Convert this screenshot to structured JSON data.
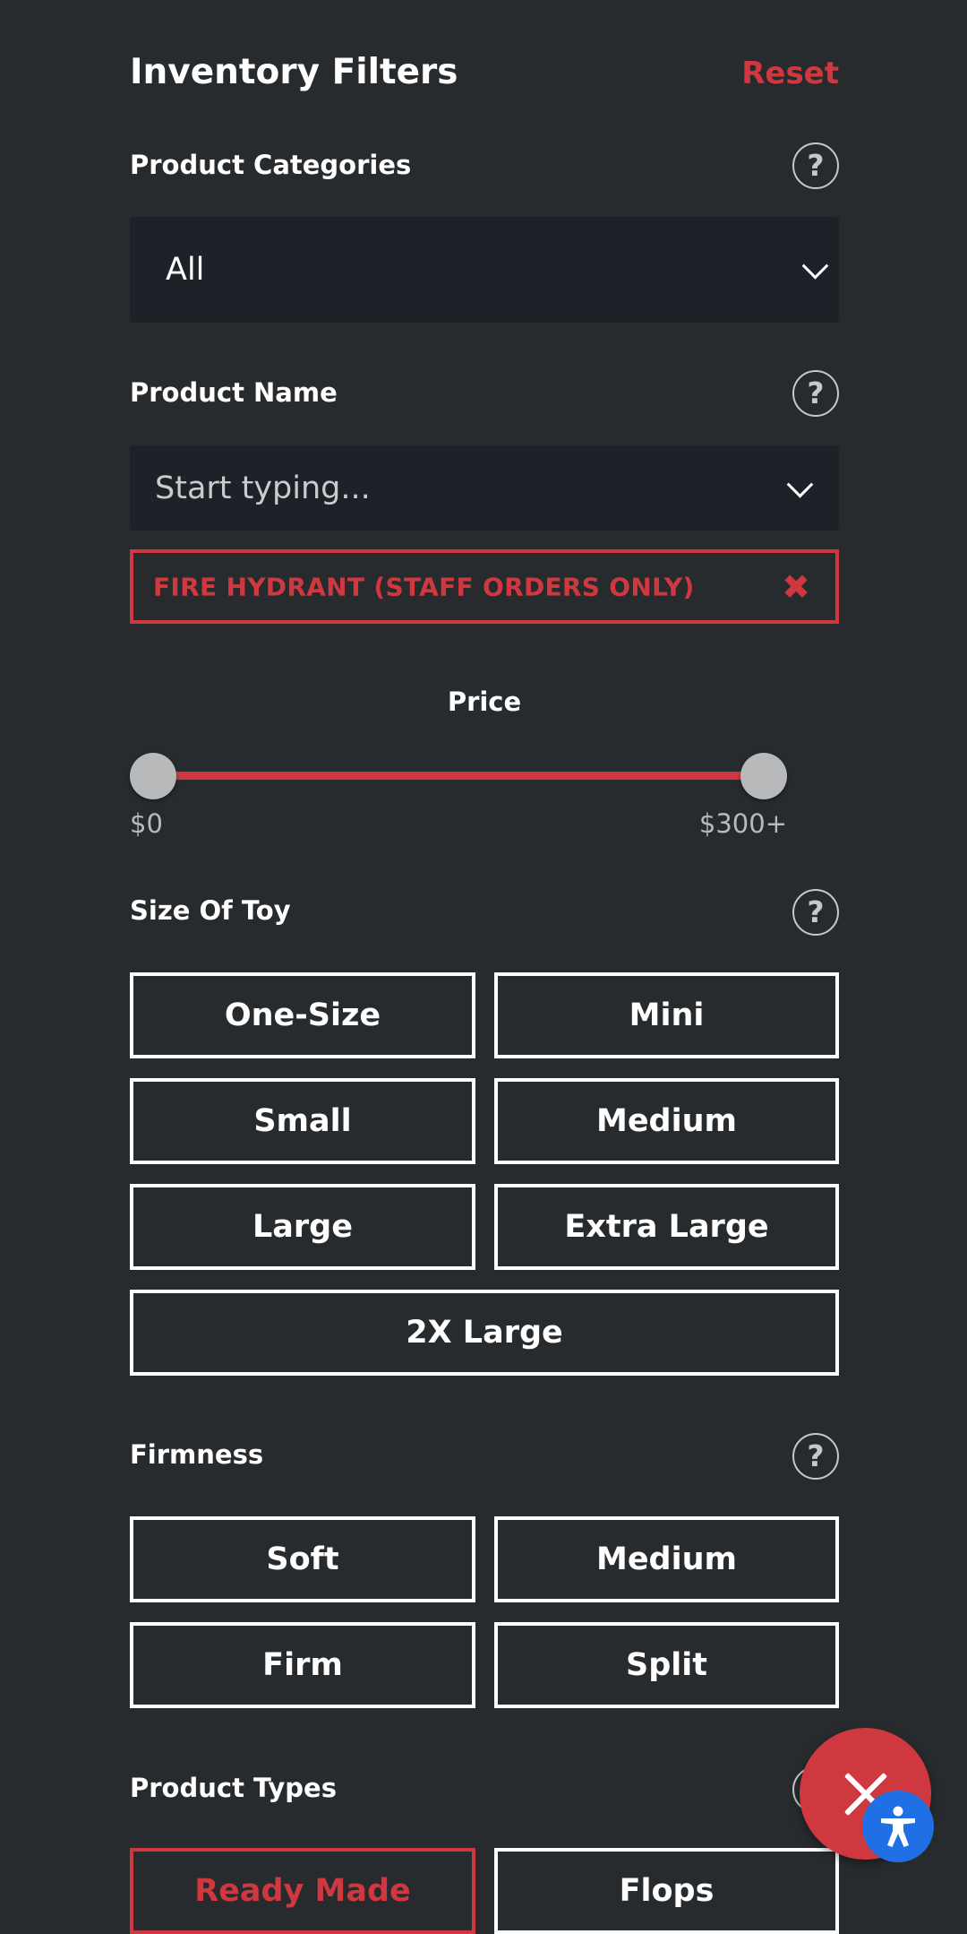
{
  "header": {
    "title": "Inventory Filters",
    "reset_label": "Reset"
  },
  "help_icon_glyph": "?",
  "sections": {
    "categories": {
      "label": "Product Categories",
      "selected_value": "All"
    },
    "product_name": {
      "label": "Product Name",
      "placeholder": "Start typing...",
      "selected_tag": "FIRE HYDRANT (STAFF ORDERS ONLY)",
      "remove_glyph": "✖"
    },
    "price": {
      "label": "Price",
      "min_label": "$0",
      "max_label": "$300+",
      "range_min": 0,
      "range_max": 300,
      "selected_min": 0,
      "selected_max": 300
    },
    "size": {
      "label": "Size Of Toy",
      "options": [
        "One-Size",
        "Mini",
        "Small",
        "Medium",
        "Large",
        "Extra Large",
        "2X Large"
      ]
    },
    "firmness": {
      "label": "Firmness",
      "options": [
        "Soft",
        "Medium",
        "Firm",
        "Split"
      ]
    },
    "product_types": {
      "label": "Product Types",
      "options": [
        "Ready Made",
        "Flops"
      ],
      "active_option": "Ready Made"
    }
  },
  "colors": {
    "background": "#272b2e",
    "accent": "#d0383f",
    "input_background": "#1e2228",
    "accessibility_button": "#1f6fe5"
  },
  "icons": {
    "close_fab": "close-icon",
    "accessibility_fab": "accessibility-icon",
    "help": "help-icon",
    "dropdown": "chevron-down-icon"
  }
}
